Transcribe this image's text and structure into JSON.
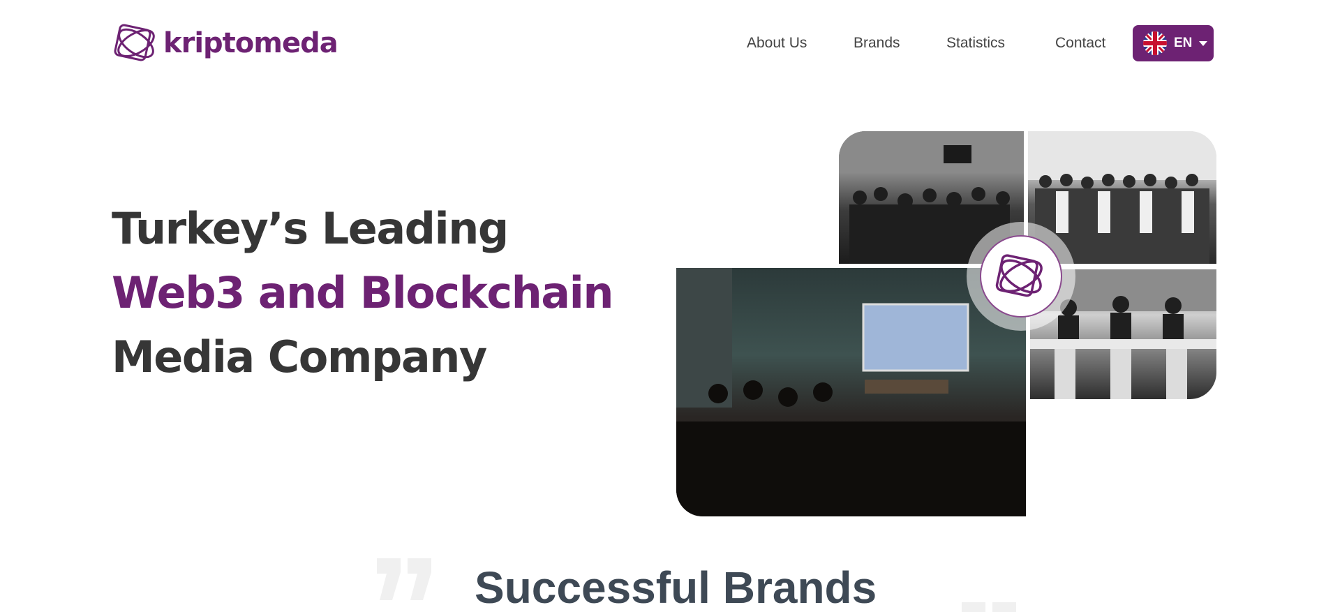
{
  "header": {
    "logo_text": "kriptomeda",
    "nav": [
      {
        "label": "About Us"
      },
      {
        "label": "Brands"
      },
      {
        "label": "Statistics"
      },
      {
        "label": "Contact"
      }
    ],
    "language": {
      "label": "EN",
      "flag_icon": "uk-flag-icon"
    }
  },
  "hero": {
    "line1": "Turkey’s Leading",
    "line2": "Web3 and Blockchain",
    "line3": "Media Company"
  },
  "brands_section": {
    "title": "Successful Brands"
  },
  "colors": {
    "brand": "#6d2273",
    "heading": "#363636",
    "nav_text": "#444444"
  }
}
